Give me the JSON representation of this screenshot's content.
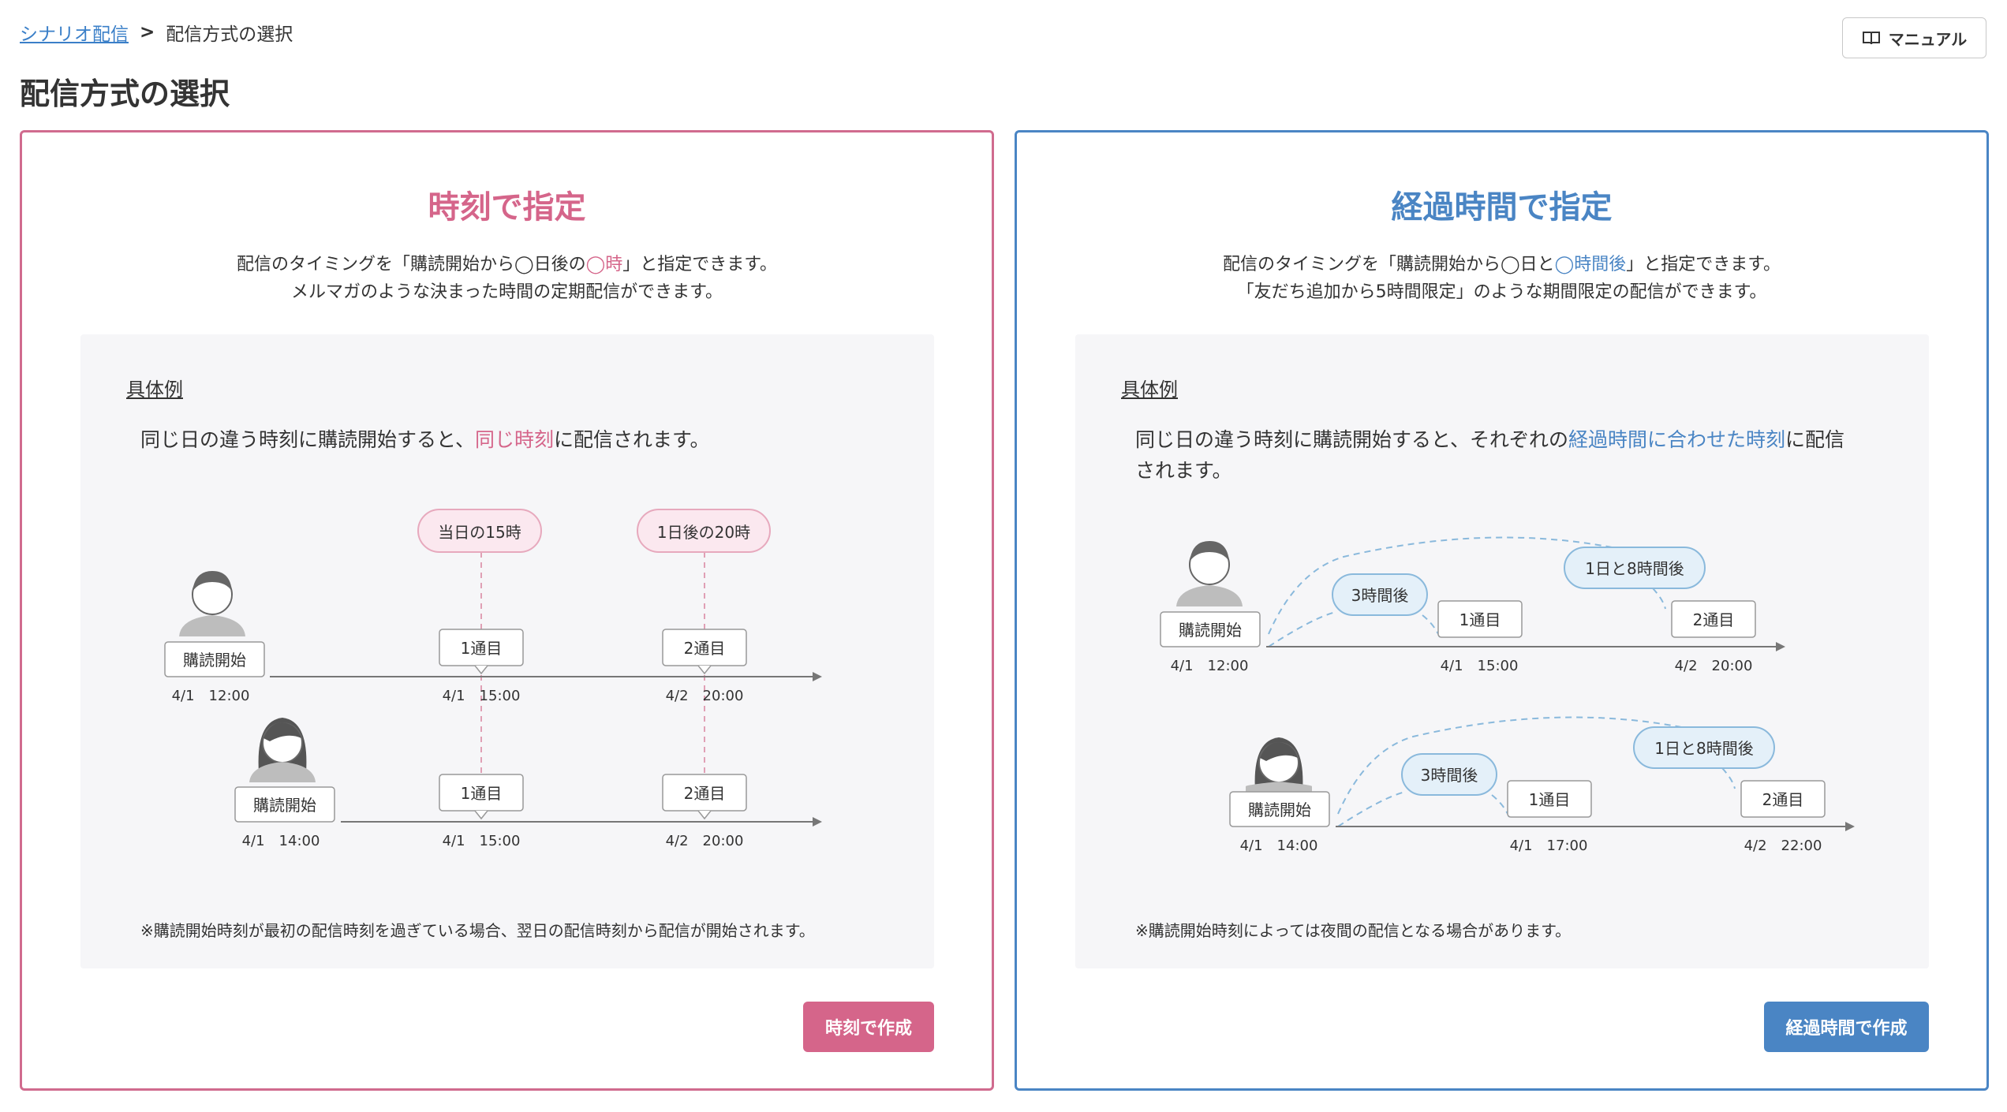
{
  "breadcrumb": {
    "link": "シナリオ配信",
    "separator": ">",
    "current": "配信方式の選択"
  },
  "manual_button": {
    "label": "マニュアル",
    "icon": "book-icon"
  },
  "page_title": "配信方式の選択",
  "colors": {
    "time_accent": "#d5658a",
    "elapsed_accent": "#4a85c4"
  },
  "time_card": {
    "title": "時刻で指定",
    "desc_line1_a": "配信のタイミングを「購読開始から◯日後の",
    "desc_line1_hl": "◯時",
    "desc_line1_b": "」と指定できます。",
    "desc_line2": "メルマガのような決まった時間の定期配信ができます。",
    "example_label": "具体例",
    "example_text_a": "同じ日の違う時刻に購読開始すると、",
    "example_text_hl": "同じ時刻",
    "example_text_b": "に配信されます。",
    "bubbles": [
      "当日の15時",
      "1日後の20時"
    ],
    "rows": [
      {
        "start_label": "購読開始",
        "start_time": "4/1　12:00",
        "msg1": "1通目",
        "msg1_time": "4/1　15:00",
        "msg2": "2通目",
        "msg2_time": "4/2　20:00"
      },
      {
        "start_label": "購読開始",
        "start_time": "4/1　14:00",
        "msg1": "1通目",
        "msg1_time": "4/1　15:00",
        "msg2": "2通目",
        "msg2_time": "4/2　20:00"
      }
    ],
    "note": "※購読開始時刻が最初の配信時刻を過ぎている場合、翌日の配信時刻から配信が開始されます。",
    "button": "時刻で作成"
  },
  "elapsed_card": {
    "title": "経過時間で指定",
    "desc_line1_a": "配信のタイミングを「購読開始から◯日と",
    "desc_line1_hl": "◯時間後",
    "desc_line1_b": "」と指定できます。",
    "desc_line2": "「友だち追加から5時間限定」のような期間限定の配信ができます。",
    "example_label": "具体例",
    "example_text_a": "同じ日の違う時刻に購読開始すると、それぞれの",
    "example_text_hl": "経過時間に合わせた時刻",
    "example_text_b": "に配信されます。",
    "rows": [
      {
        "start_label": "購読開始",
        "start_time": "4/1　12:00",
        "bubble1": "3時間後",
        "bubble2": "1日と8時間後",
        "msg1": "1通目",
        "msg1_time": "4/1　15:00",
        "msg2": "2通目",
        "msg2_time": "4/2　20:00"
      },
      {
        "start_label": "購読開始",
        "start_time": "4/1　14:00",
        "bubble1": "3時間後",
        "bubble2": "1日と8時間後",
        "msg1": "1通目",
        "msg1_time": "4/1　17:00",
        "msg2": "2通目",
        "msg2_time": "4/2　22:00"
      }
    ],
    "note": "※購読開始時刻によっては夜間の配信となる場合があります。",
    "button": "経過時間で作成"
  }
}
